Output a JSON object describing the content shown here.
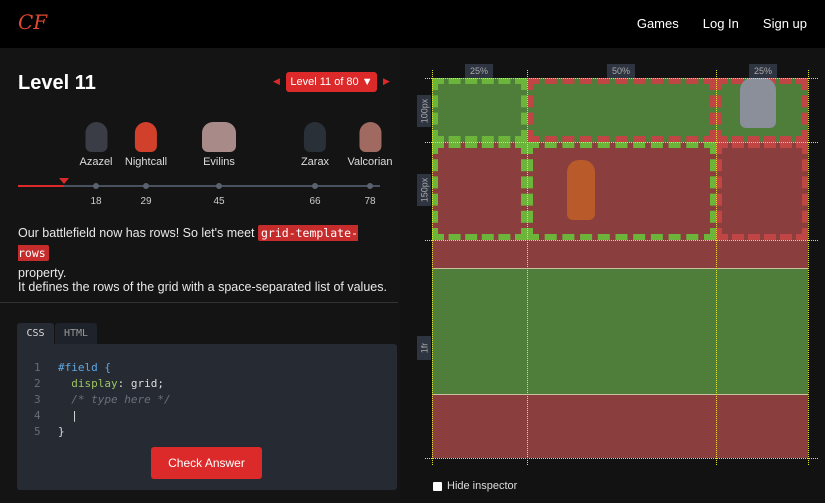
{
  "header": {
    "logo": "CF",
    "nav": [
      "Games",
      "Log In",
      "Sign up"
    ]
  },
  "level": {
    "title": "Level 11",
    "selector": "Level 11 of 80 ▼",
    "prev": "◀",
    "next": "▶"
  },
  "enemies": [
    {
      "name": "Azazel",
      "level": "18",
      "color": "#3a3d45"
    },
    {
      "name": "Nightcall",
      "level": "29",
      "color": "#d0402a"
    },
    {
      "name": "Evilins",
      "level": "45",
      "color": "#a88a88"
    },
    {
      "name": "Zarax",
      "level": "66",
      "color": "#2a3038"
    },
    {
      "name": "Valcorian",
      "level": "78",
      "color": "#a06a60"
    }
  ],
  "progress": {
    "current_level": 11,
    "total_levels": 80
  },
  "instructions": {
    "p1_a": "Our battlefield now has rows! So let's meet ",
    "p1_code": "grid-template-rows",
    "p1_b": " property.",
    "p2": "It defines the rows of the grid with a space-separated list of values."
  },
  "editor": {
    "tabs": [
      "CSS",
      "HTML"
    ],
    "lines": {
      "n": [
        "1",
        "2",
        "3",
        "4",
        "5"
      ],
      "l1": "#field {",
      "l2_prop": "display",
      "l2_val": ": grid;",
      "l3": "/* type here */",
      "l5": "}"
    },
    "check": "Check Answer"
  },
  "inspector": {
    "cols": [
      "25%",
      "50%",
      "25%"
    ],
    "rows": [
      "100px",
      "150px",
      "1fr"
    ],
    "hide": "Hide inspector"
  }
}
